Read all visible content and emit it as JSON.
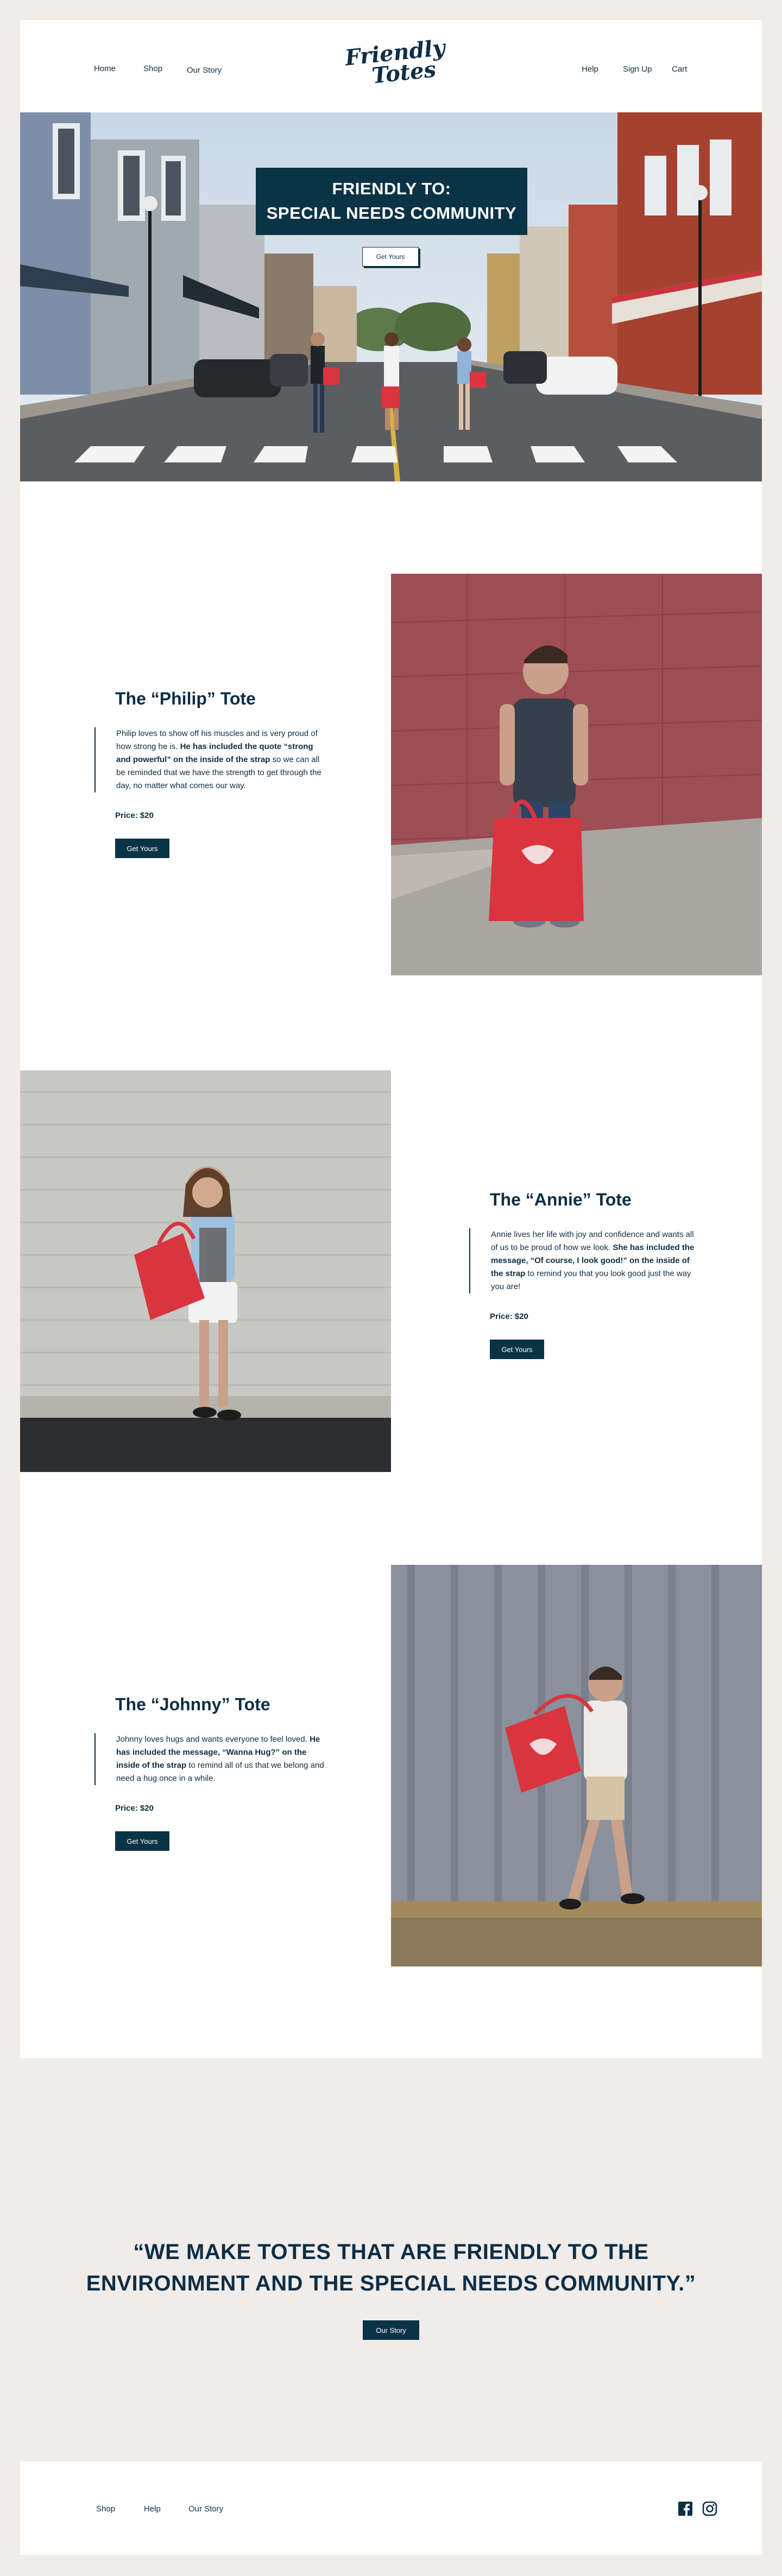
{
  "header": {
    "nav_left": [
      "Home",
      "Shop",
      "Our Story"
    ],
    "logo_line1": "Friendly",
    "logo_line2": "Totes",
    "nav_right": [
      "Help",
      "Sign Up",
      "Cart"
    ]
  },
  "hero": {
    "title_line1": "FRIENDLY TO:",
    "title_line2": "SPECIAL NEEDS COMMUNITY",
    "button": "Get Yours"
  },
  "products": [
    {
      "title": "The “Philip” Tote",
      "desc_plain1": "Philip loves to show off his muscles and is very proud of how strong he is. ",
      "desc_bold": "He has included the quote “strong and powerful” on the inside of the strap",
      "desc_plain2": " so we can all be reminded that we have the strength to get through the day, no matter what comes our way.",
      "price": "Price: $20",
      "button": "Get Yours"
    },
    {
      "title": "The “Annie” Tote",
      "desc_plain1": "Annie lives her life with joy and confidence and wants all of us to be proud of how we look. ",
      "desc_bold": "She has included the message, “Of course, I look good!” on the inside of the strap",
      "desc_plain2": " to remind you that you look good just the way you are!",
      "price": "Price: $20",
      "button": "Get Yours"
    },
    {
      "title": "The “Johnny” Tote",
      "desc_plain1": "Johnny loves hugs and wants everyone to feel loved. ",
      "desc_bold": "He has included the message, “Wanna Hug?” on the inside of the strap",
      "desc_plain2": " to remind all of us that we belong and need a hug once in a while.",
      "price": "Price: $20",
      "button": "Get Yours"
    }
  ],
  "quote": {
    "line1": "“WE MAKE TOTES THAT ARE FRIENDLY TO THE",
    "line2": "ENVIRONMENT AND THE SPECIAL NEEDS COMMUNITY.”",
    "button": "Our Story"
  },
  "footer": {
    "links": [
      "Shop",
      "Help",
      "Our Story"
    ],
    "social_icons": [
      "facebook-icon",
      "instagram-icon"
    ]
  },
  "colors": {
    "navy": "#0b3346",
    "tote_red": "#d9343f",
    "page_bg": "#f0ecea"
  }
}
